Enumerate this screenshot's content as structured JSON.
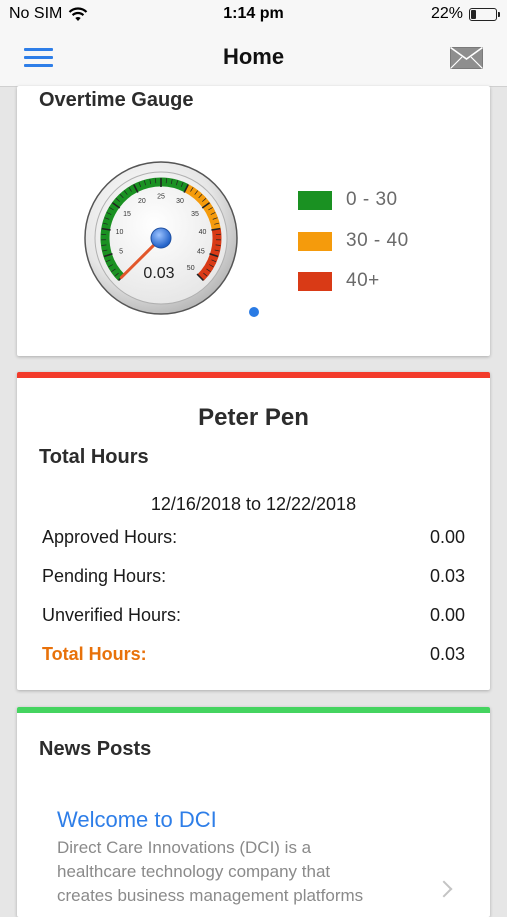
{
  "status_bar": {
    "carrier": "No SIM",
    "time": "1:14 pm",
    "battery": "22%",
    "battery_level": 0.22
  },
  "navbar": {
    "title": "Home",
    "menu_icon": "hamburger-menu-icon",
    "mail_icon": "envelope-icon"
  },
  "gauge_card": {
    "title": "Overtime Gauge",
    "value": 0.03,
    "value_label": "0.03",
    "scale_min": 0,
    "scale_max": 50,
    "ticks": [
      "5",
      "10",
      "15",
      "20",
      "25",
      "30",
      "35",
      "40",
      "45",
      "50"
    ],
    "legend": [
      {
        "label": "0 - 30",
        "color": "#1a9122"
      },
      {
        "label": "30 - 40",
        "color": "#f59b0c"
      },
      {
        "label": "40+",
        "color": "#d93a16"
      }
    ]
  },
  "hours_card": {
    "accent_color": "#f23a2a",
    "person": "Peter Pen",
    "title": "Total Hours",
    "date_range": "12/16/2018 to 12/22/2018",
    "rows": [
      {
        "label": "Approved Hours:",
        "value": "0.00"
      },
      {
        "label": "Pending Hours:",
        "value": "0.03"
      },
      {
        "label": "Unverified Hours:",
        "value": "0.00"
      },
      {
        "label": "Total Hours:",
        "value": "0.03"
      }
    ]
  },
  "news_card": {
    "accent_color": "#45d460",
    "title": "News Posts",
    "post": {
      "title": "Welcome to DCI",
      "line1": "Direct Care Innovations (DCI) is a",
      "line2": "healthcare technology company that",
      "line3": "creates business management platforms"
    }
  }
}
